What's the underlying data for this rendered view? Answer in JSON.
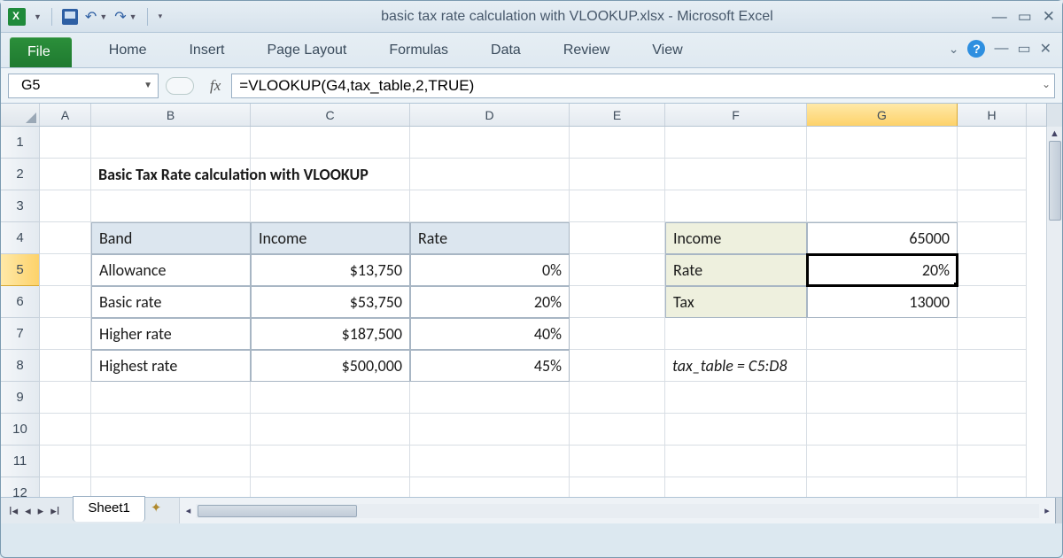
{
  "app": {
    "title": "basic tax rate calculation with VLOOKUP.xlsx  -  Microsoft Excel"
  },
  "ribbon": {
    "file": "File",
    "tabs": [
      "Home",
      "Insert",
      "Page Layout",
      "Formulas",
      "Data",
      "Review",
      "View"
    ]
  },
  "namebox": "G5",
  "fx_label": "fx",
  "formula": "=VLOOKUP(G4,tax_table,2,TRUE)",
  "columns": [
    "A",
    "B",
    "C",
    "D",
    "E",
    "F",
    "G",
    "H"
  ],
  "active_col": "G",
  "rows": [
    "1",
    "2",
    "3",
    "4",
    "5",
    "6",
    "7",
    "8",
    "9",
    "10",
    "11",
    "12"
  ],
  "active_row": "5",
  "sheet_title": "Basic Tax Rate calculation with VLOOKUP",
  "tax_table": {
    "headers": {
      "band": "Band",
      "income": "Income",
      "rate": "Rate"
    },
    "rows": [
      {
        "band": "Allowance",
        "income": "$13,750",
        "rate": "0%"
      },
      {
        "band": "Basic rate",
        "income": "$53,750",
        "rate": "20%"
      },
      {
        "band": "Higher rate",
        "income": "$187,500",
        "rate": "40%"
      },
      {
        "band": "Highest rate",
        "income": "$500,000",
        "rate": "45%"
      }
    ]
  },
  "calc": {
    "income_label": "Income",
    "income_value": "65000",
    "rate_label": "Rate",
    "rate_value": "20%",
    "tax_label": "Tax",
    "tax_value": "13000"
  },
  "note": "tax_table = C5:D8",
  "sheet_tab": "Sheet1",
  "chart_data": {
    "type": "table",
    "title": "Basic Tax Rate calculation with VLOOKUP",
    "columns": [
      "Band",
      "Income",
      "Rate"
    ],
    "rows": [
      [
        "Allowance",
        13750,
        0.0
      ],
      [
        "Basic rate",
        53750,
        0.2
      ],
      [
        "Higher rate",
        187500,
        0.4
      ],
      [
        "Highest rate",
        500000,
        0.45
      ]
    ],
    "lookup": {
      "Income": 65000,
      "Rate": 0.2,
      "Tax": 13000
    }
  }
}
